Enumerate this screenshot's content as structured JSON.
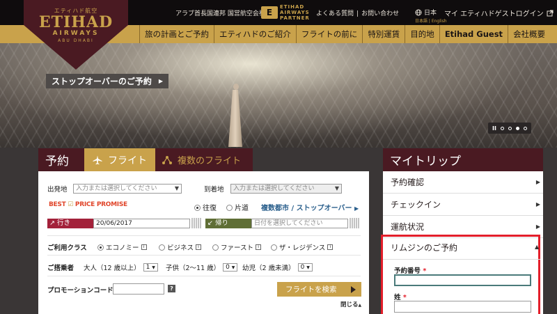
{
  "logo": {
    "jp": "エティハド航空",
    "main": "ETIHAD",
    "sub": "AIRWAYS",
    "city": "ABU DHABI"
  },
  "header": {
    "national_carrier": "アラブ首長国連邦 国営航空会社",
    "partner_badge": "E",
    "partner_lines": [
      "ETIHAD",
      "AIRWAYS",
      "PARTNER"
    ],
    "faq": "よくある質問",
    "divider": "|",
    "contact": "お問い合わせ",
    "lang_current": "日本",
    "lang_options": "日本語 | English",
    "login": "マイ エティハドゲストログイン"
  },
  "nav": [
    "旅の計画とご予約",
    "エティハドのご紹介",
    "フライトの前に",
    "特別運賃",
    "目的地",
    "Etihad Guest",
    "会社概要"
  ],
  "hero": {
    "banner": "ストップオーバーのご予約",
    "pause_label": "II",
    "slide_active": 3,
    "slide_count": 4
  },
  "booking": {
    "title": "予約",
    "tab_flight": "フライト",
    "tab_multi": "複数のフライト",
    "origin_label": "出発地",
    "origin_placeholder": "入力または選択してください",
    "dest_label": "到着地",
    "dest_placeholder": "入力または選択してください",
    "bpp_prefix": "BEST",
    "bpp_mark": "☑",
    "bpp_suffix": "PRICE PROMISE",
    "trip_roundtrip": "往復",
    "trip_oneway": "片道",
    "multi_link": "複数都市 / ストップオーバー",
    "depart_label": "行き",
    "depart_value": "20/06/2017",
    "return_label": "帰り",
    "return_placeholder": "日付を選択してください",
    "class_label": "ご利用クラス",
    "classes": [
      "エコノミー",
      "ビジネス",
      "ファースト",
      "ザ・レジデンス"
    ],
    "info_mark": "i",
    "pax_label": "ご搭乗者",
    "adults_label": "大人（12 歳以上）",
    "adults_value": "1",
    "children_label": "子供（2〜11 歳）",
    "children_value": "0",
    "infants_label": "幼児（2 歳未満）",
    "infants_value": "0",
    "promo_label": "プロモーションコード",
    "help_mark": "?",
    "search_button": "フライトを検索",
    "close_link": "閉じる"
  },
  "trip": {
    "title": "マイトリップ",
    "items": [
      "予約確認",
      "チェックイン",
      "運航状況"
    ],
    "limo_title": "リムジンのご予約",
    "booking_ref_label": "予約番号",
    "surname_label": "姓",
    "required_mark": "*"
  },
  "colors": {
    "gold": "#c9a24b",
    "maroon": "#4a1a22",
    "highlight": "#e31e2a"
  }
}
